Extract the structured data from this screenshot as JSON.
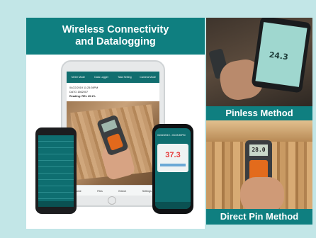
{
  "left_banner": {
    "line1": "Wireless Connectivity",
    "line2": "and Datalogging"
  },
  "tablet": {
    "menu": [
      "Meter Mode",
      "Data Logger",
      "Task Setting",
      "Camera Mode"
    ],
    "info": [
      "04/22/2019 11:25:39PM",
      "DATG 1562007",
      "Reading: REL 29.1%"
    ],
    "bottom": [
      "Home",
      "Files",
      "Extech",
      "Settings"
    ]
  },
  "right_phone": {
    "reading": "37.3",
    "stamp": "04/22/2019 - 03:03:39PM"
  },
  "photo_top": {
    "display": "24.3"
  },
  "photo_bottom": {
    "display": "28.0"
  },
  "captions": {
    "pinless": "Pinless Method",
    "direct": "Direct Pin Method"
  },
  "colors": {
    "background": "#c2e6e7",
    "accent": "#0f7f80"
  }
}
